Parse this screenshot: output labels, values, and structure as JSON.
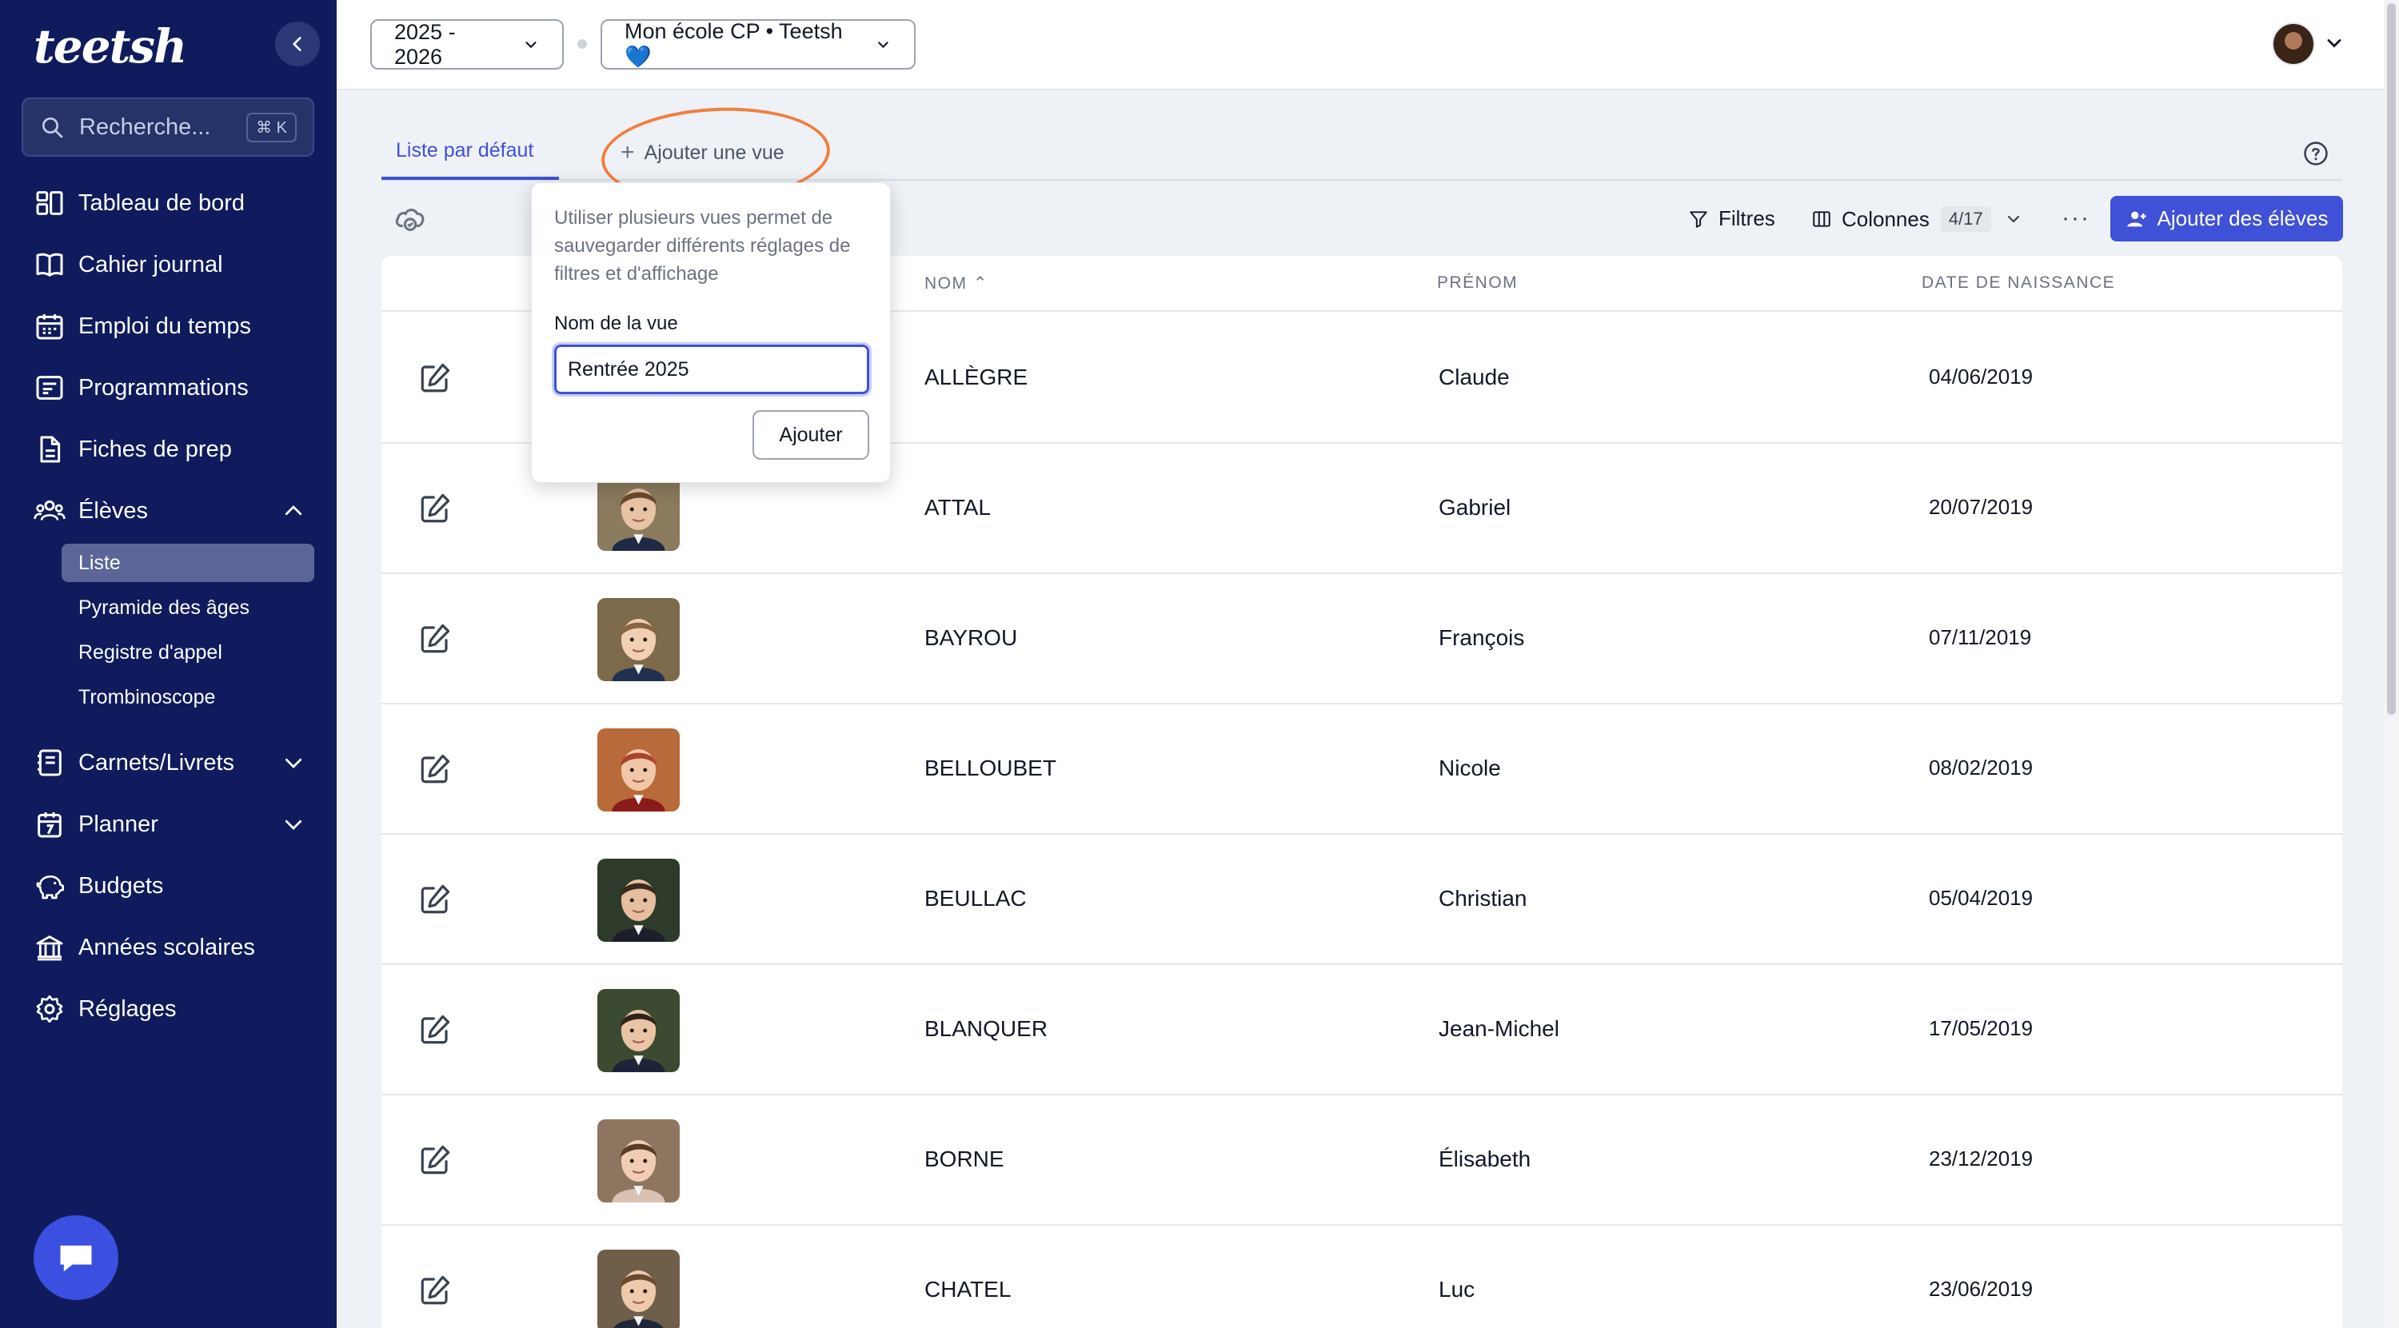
{
  "sidebar": {
    "logo_text": "teetsh",
    "search": {
      "placeholder": "Recherche...",
      "shortcut": "⌘ K"
    },
    "items": [
      {
        "label": "Tableau de bord",
        "icon": "dashboard-icon"
      },
      {
        "label": "Cahier journal",
        "icon": "book-icon"
      },
      {
        "label": "Emploi du temps",
        "icon": "calendar-icon"
      },
      {
        "label": "Programmations",
        "icon": "list-icon"
      },
      {
        "label": "Fiches de prep",
        "icon": "file-icon"
      },
      {
        "label": "Élèves",
        "icon": "students-icon",
        "expanded": true
      },
      {
        "label": "Carnets/Livrets",
        "icon": "notebook-icon"
      },
      {
        "label": "Planner",
        "icon": "planner-icon"
      },
      {
        "label": "Budgets",
        "icon": "piggy-bank-icon"
      },
      {
        "label": "Années scolaires",
        "icon": "school-icon"
      },
      {
        "label": "Réglages",
        "icon": "gear-icon"
      }
    ],
    "eleves_subitems": [
      "Liste",
      "Pyramide des âges",
      "Registre d'appel",
      "Trombinoscope"
    ],
    "active_subitem": "Liste"
  },
  "topbar": {
    "year_select": "2025 - 2026",
    "class_select": "Mon école CP • Teetsh 💙"
  },
  "tabs": {
    "default_tab": "Liste par défaut",
    "add_view": "Ajouter une vue"
  },
  "toolbar": {
    "filters_label": "Filtres",
    "columns_label": "Colonnes",
    "columns_count": "4/17",
    "more_label": "···",
    "add_students_label": "Ajouter des élèves"
  },
  "table": {
    "headers": {
      "nom": "NOM ⌃",
      "prenom": "PRÉNOM",
      "date": "DATE DE NAISSANCE"
    },
    "rows": [
      {
        "nom": "ALLÈGRE",
        "prenom": "Claude",
        "date": "04/06/2019",
        "photo": false
      },
      {
        "nom": "ATTAL",
        "prenom": "Gabriel",
        "date": "20/07/2019",
        "photo": true
      },
      {
        "nom": "BAYROU",
        "prenom": "François",
        "date": "07/11/2019",
        "photo": true
      },
      {
        "nom": "BELLOUBET",
        "prenom": "Nicole",
        "date": "08/02/2019",
        "photo": true
      },
      {
        "nom": "BEULLAC",
        "prenom": "Christian",
        "date": "05/04/2019",
        "photo": true
      },
      {
        "nom": "BLANQUER",
        "prenom": "Jean-Michel",
        "date": "17/05/2019",
        "photo": true
      },
      {
        "nom": "BORNE",
        "prenom": "Élisabeth",
        "date": "23/12/2019",
        "photo": true
      },
      {
        "nom": "CHATEL",
        "prenom": "Luc",
        "date": "23/06/2019",
        "photo": true
      }
    ]
  },
  "popover": {
    "description": "Utiliser plusieurs vues permet de sauvegarder différents réglages de filtres et d'affichage",
    "field_label": "Nom de la vue",
    "field_value": "Rentrée 2025",
    "submit_label": "Ajouter"
  },
  "colors": {
    "sidebar_bg": "#0f1b5c",
    "accent": "#3f51d6",
    "highlight": "#f07f3f"
  }
}
